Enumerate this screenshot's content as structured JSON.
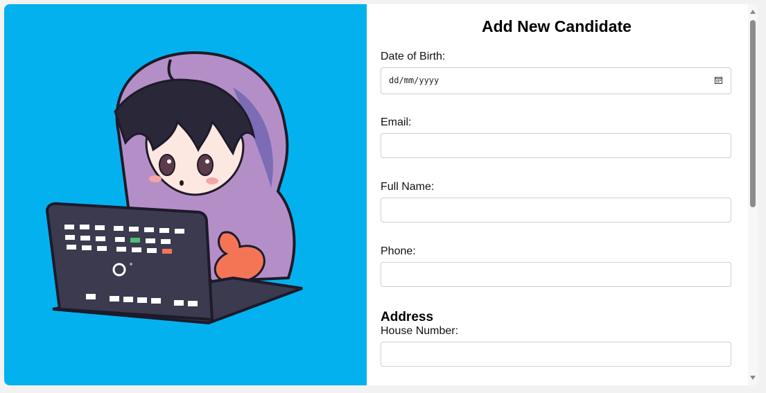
{
  "form": {
    "title": "Add New Candidate",
    "fields": {
      "dob": {
        "label": "Date of Birth:",
        "placeholder": "dd/mm/yyyy"
      },
      "email": {
        "label": "Email:",
        "value": ""
      },
      "full_name": {
        "label": "Full Name:",
        "value": ""
      },
      "phone": {
        "label": "Phone:",
        "value": ""
      }
    },
    "address": {
      "heading": "Address",
      "house_number": {
        "label": "House Number:",
        "value": ""
      }
    }
  },
  "illustration": {
    "subject": "chibi hacker in purple hoodie using laptop",
    "background_color": "#04b1ef"
  },
  "colors": {
    "accent_blue": "#04b1ef",
    "hoodie_purple": "#b48fc7",
    "input_border": "#cfcfcf"
  }
}
